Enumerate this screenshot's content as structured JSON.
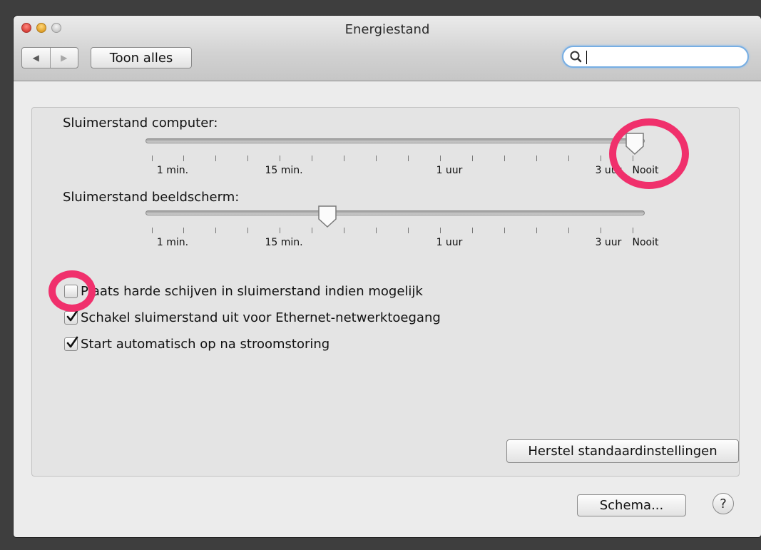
{
  "window": {
    "title": "Energiestand",
    "toolbar": {
      "back_icon": "◀",
      "forward_icon": "▶",
      "show_all_label": "Toon alles",
      "search_value": ""
    }
  },
  "settings": {
    "computer_sleep": {
      "label": "Sluimerstand computer:",
      "value_label": "Nooit",
      "tick_labels": [
        "1 min.",
        "15 min.",
        "1 uur",
        "3 uur",
        "Nooit"
      ]
    },
    "display_sleep": {
      "label": "Sluimerstand beeldscherm:",
      "value_fraction": 0.37,
      "tick_labels": [
        "1 min.",
        "15 min.",
        "1 uur",
        "3 uur",
        "Nooit"
      ]
    },
    "checkboxes": [
      {
        "label": "Plaats harde schijven in sluimerstand indien mogelijk",
        "checked": false
      },
      {
        "label": "Schakel sluimerstand uit voor Ethernet-netwerktoegang",
        "checked": true
      },
      {
        "label": "Start automatisch op na stroomstoring",
        "checked": true
      }
    ],
    "restore_defaults_label": "Herstel standaardinstellingen"
  },
  "footer": {
    "schedule_label": "Schema...",
    "help_label": "?"
  },
  "annotations": {
    "highlight_color": "#f0306c"
  }
}
